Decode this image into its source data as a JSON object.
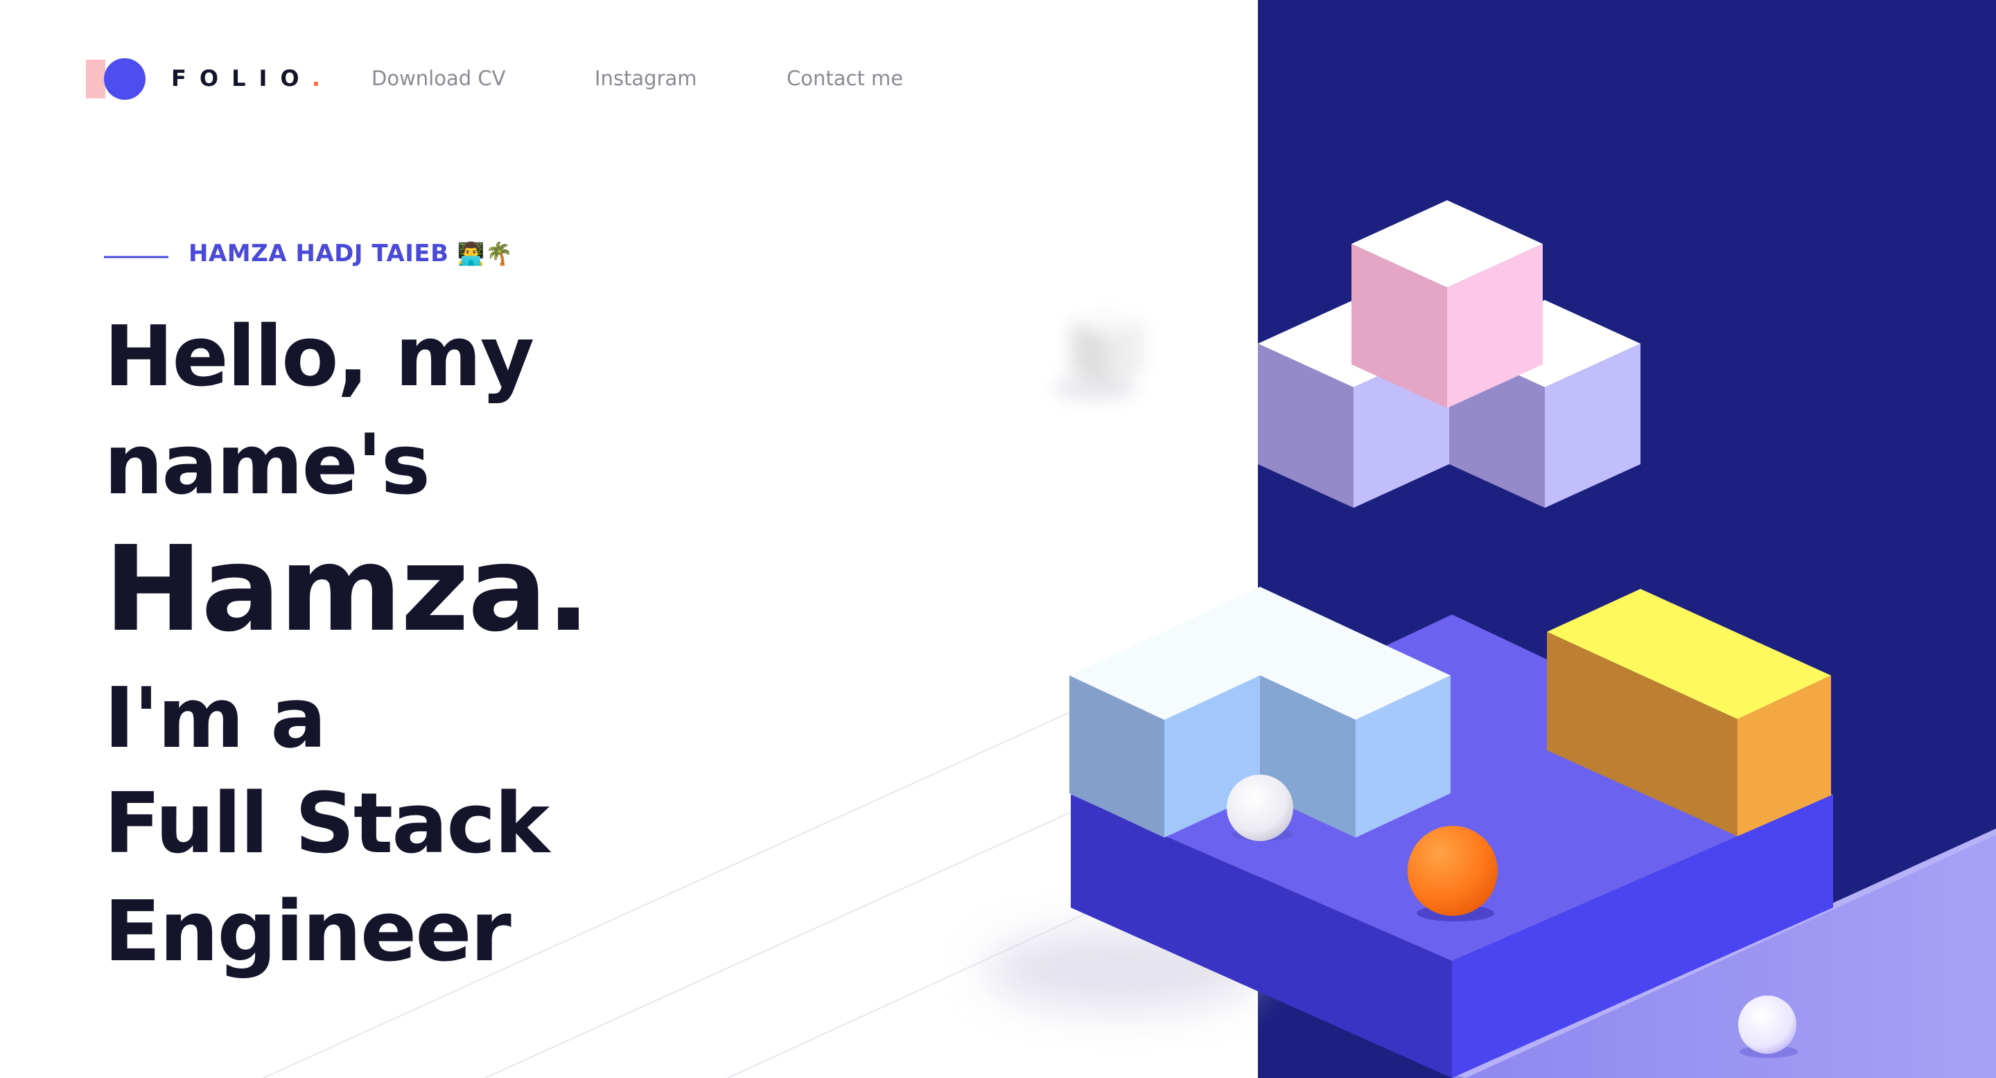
{
  "nav": {
    "logo_text": "FOLIO",
    "logo_dot": ".",
    "links": [
      "Download CV",
      "Instagram",
      "Contact me"
    ]
  },
  "hero": {
    "tagline": "HAMZA HADJ TAIEB",
    "tagline_emoji": [
      "technologist-icon",
      "palm-tree-icon"
    ],
    "lines": [
      "Hello, my",
      "name's",
      "Hamza.",
      "I'm a",
      "Full Stack",
      "Engineer"
    ]
  },
  "colors": {
    "accent": "#4a4ad8",
    "dark_panel": "#1c2180",
    "platform": "#6b63f0",
    "text_dark": "#14142a",
    "nav_text": "#8a8a93",
    "logo_pink": "#f9bfc2",
    "logo_circle": "#4d4df0",
    "dot_orange": "#ff6a3d"
  }
}
